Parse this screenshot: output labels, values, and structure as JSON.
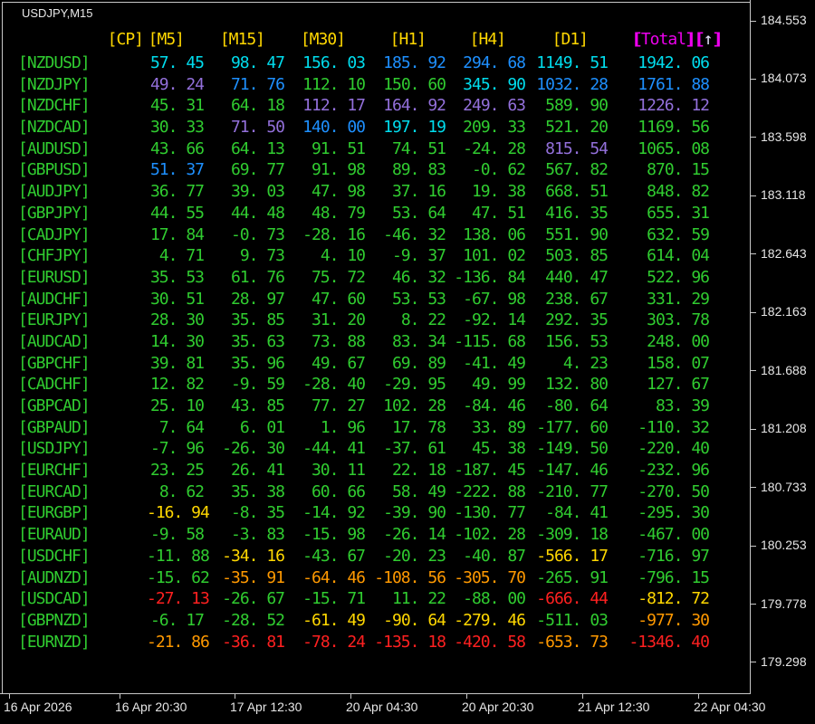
{
  "window": {
    "title": "USDJPY,M15"
  },
  "strength_table": {
    "cp_header": "[CP]",
    "tf_headers": [
      "[M5]",
      "[M15]",
      "[M30]",
      "[H1]",
      "[H4]",
      "[D1]"
    ],
    "total_header_text": "【Total】【↑】",
    "total_label": "Total",
    "sort_arrow": "↑",
    "rows": [
      {
        "pair": "[NZDUSD]",
        "values": [
          57.45,
          98.47,
          156.03,
          185.92,
          294.68,
          1149.51,
          1942.06
        ],
        "ranks": [
          "t1",
          "t1",
          "t1",
          "t2",
          "t2",
          "t1",
          "t1"
        ]
      },
      {
        "pair": "[NZDJPY]",
        "values": [
          49.24,
          71.76,
          112.1,
          150.6,
          345.9,
          1032.28,
          1761.88
        ],
        "ranks": [
          "t3",
          "t2",
          "d",
          "d",
          "t1",
          "t2",
          "t2"
        ]
      },
      {
        "pair": "[NZDCHF]",
        "values": [
          45.31,
          64.18,
          112.17,
          164.92,
          249.63,
          589.9,
          1226.12
        ],
        "ranks": [
          "d",
          "d",
          "t3",
          "t3",
          "t3",
          "d",
          "t3"
        ]
      },
      {
        "pair": "[NZDCAD]",
        "values": [
          30.33,
          71.5,
          140.0,
          197.19,
          209.33,
          521.2,
          1169.56
        ],
        "ranks": [
          "d",
          "t3",
          "t2",
          "t1",
          "d",
          "d",
          "d"
        ]
      },
      {
        "pair": "[AUDUSD]",
        "values": [
          43.66,
          64.13,
          91.51,
          74.51,
          -24.28,
          815.54,
          1065.08
        ],
        "ranks": [
          "d",
          "d",
          "d",
          "d",
          "d",
          "t3",
          "d"
        ]
      },
      {
        "pair": "[GBPUSD]",
        "values": [
          51.37,
          69.77,
          91.98,
          89.83,
          -0.62,
          567.82,
          870.15
        ],
        "ranks": [
          "t2",
          "d",
          "d",
          "d",
          "d",
          "d",
          "d"
        ]
      },
      {
        "pair": "[AUDJPY]",
        "values": [
          36.77,
          39.03,
          47.98,
          37.16,
          19.38,
          668.51,
          848.82
        ],
        "ranks": [
          "d",
          "d",
          "d",
          "d",
          "d",
          "d",
          "d"
        ]
      },
      {
        "pair": "[GBPJPY]",
        "values": [
          44.55,
          44.48,
          48.79,
          53.64,
          47.51,
          416.35,
          655.31
        ],
        "ranks": [
          "d",
          "d",
          "d",
          "d",
          "d",
          "d",
          "d"
        ]
      },
      {
        "pair": "[CADJPY]",
        "values": [
          17.84,
          -0.73,
          -28.16,
          -46.32,
          138.06,
          551.9,
          632.59
        ],
        "ranks": [
          "d",
          "d",
          "d",
          "d",
          "d",
          "d",
          "d"
        ]
      },
      {
        "pair": "[CHFJPY]",
        "values": [
          4.71,
          9.73,
          4.1,
          -9.37,
          101.02,
          503.85,
          614.04
        ],
        "ranks": [
          "d",
          "d",
          "d",
          "d",
          "d",
          "d",
          "d"
        ]
      },
      {
        "pair": "[EURUSD]",
        "values": [
          35.53,
          61.76,
          75.72,
          46.32,
          -136.84,
          440.47,
          522.96
        ],
        "ranks": [
          "d",
          "d",
          "d",
          "d",
          "d",
          "d",
          "d"
        ]
      },
      {
        "pair": "[AUDCHF]",
        "values": [
          30.51,
          28.97,
          47.6,
          53.53,
          -67.98,
          238.67,
          331.29
        ],
        "ranks": [
          "d",
          "d",
          "d",
          "d",
          "d",
          "d",
          "d"
        ]
      },
      {
        "pair": "[EURJPY]",
        "values": [
          28.3,
          35.85,
          31.2,
          8.22,
          -92.14,
          292.35,
          303.78
        ],
        "ranks": [
          "d",
          "d",
          "d",
          "d",
          "d",
          "d",
          "d"
        ]
      },
      {
        "pair": "[AUDCAD]",
        "values": [
          14.3,
          35.63,
          73.88,
          83.34,
          -115.68,
          156.53,
          248.0
        ],
        "ranks": [
          "d",
          "d",
          "d",
          "d",
          "d",
          "d",
          "d"
        ]
      },
      {
        "pair": "[GBPCHF]",
        "values": [
          39.81,
          35.96,
          49.67,
          69.89,
          -41.49,
          4.23,
          158.07
        ],
        "ranks": [
          "d",
          "d",
          "d",
          "d",
          "d",
          "d",
          "d"
        ]
      },
      {
        "pair": "[CADCHF]",
        "values": [
          12.82,
          -9.59,
          -28.4,
          -29.95,
          49.99,
          132.8,
          127.67
        ],
        "ranks": [
          "d",
          "d",
          "d",
          "d",
          "d",
          "d",
          "d"
        ]
      },
      {
        "pair": "[GBPCAD]",
        "values": [
          25.1,
          43.85,
          77.27,
          102.28,
          -84.46,
          -80.64,
          83.39
        ],
        "ranks": [
          "d",
          "d",
          "d",
          "d",
          "d",
          "d",
          "d"
        ]
      },
      {
        "pair": "[GBPAUD]",
        "values": [
          7.64,
          6.01,
          1.96,
          17.78,
          33.89,
          -177.6,
          -110.32
        ],
        "ranks": [
          "d",
          "d",
          "d",
          "d",
          "d",
          "d",
          "d"
        ]
      },
      {
        "pair": "[USDJPY]",
        "values": [
          -7.96,
          -26.3,
          -44.41,
          -37.61,
          45.38,
          -149.5,
          -220.4
        ],
        "ranks": [
          "d",
          "d",
          "d",
          "d",
          "d",
          "d",
          "d"
        ]
      },
      {
        "pair": "[EURCHF]",
        "values": [
          23.25,
          26.41,
          30.11,
          22.18,
          -187.45,
          -147.46,
          -232.96
        ],
        "ranks": [
          "d",
          "d",
          "d",
          "d",
          "d",
          "d",
          "d"
        ]
      },
      {
        "pair": "[EURCAD]",
        "values": [
          8.62,
          35.38,
          60.66,
          58.49,
          -222.88,
          -210.77,
          -270.5
        ],
        "ranks": [
          "d",
          "d",
          "d",
          "d",
          "d",
          "d",
          "d"
        ]
      },
      {
        "pair": "[EURGBP]",
        "values": [
          -16.94,
          -8.35,
          -14.92,
          -39.9,
          -130.77,
          -84.41,
          -295.3
        ],
        "ranks": [
          "b3",
          "d",
          "d",
          "d",
          "d",
          "d",
          "d"
        ]
      },
      {
        "pair": "[EURAUD]",
        "values": [
          -9.58,
          -3.83,
          -15.98,
          -26.14,
          -102.28,
          -309.18,
          -467.0
        ],
        "ranks": [
          "d",
          "d",
          "d",
          "d",
          "d",
          "d",
          "d"
        ]
      },
      {
        "pair": "[USDCHF]",
        "values": [
          -11.88,
          -34.16,
          -43.67,
          -20.23,
          -40.87,
          -566.17,
          -716.97
        ],
        "ranks": [
          "d",
          "b3",
          "d",
          "d",
          "d",
          "b3",
          "d"
        ]
      },
      {
        "pair": "[AUDNZD]",
        "values": [
          -15.62,
          -35.91,
          -64.46,
          -108.56,
          -305.7,
          -265.91,
          -796.15
        ],
        "ranks": [
          "d",
          "b2",
          "b2",
          "b2",
          "b2",
          "d",
          "d"
        ]
      },
      {
        "pair": "[USDCAD]",
        "values": [
          -27.13,
          -26.67,
          -15.71,
          11.22,
          -88.0,
          -666.44,
          -812.72
        ],
        "ranks": [
          "b1",
          "d",
          "d",
          "d",
          "d",
          "b1",
          "b3"
        ]
      },
      {
        "pair": "[GBPNZD]",
        "values": [
          -6.17,
          -28.52,
          -61.49,
          -90.64,
          -279.46,
          -511.03,
          -977.3
        ],
        "ranks": [
          "d",
          "d",
          "b3",
          "b3",
          "b3",
          "d",
          "b2"
        ]
      },
      {
        "pair": "[EURNZD]",
        "values": [
          -21.86,
          -36.81,
          -78.24,
          -135.18,
          -420.58,
          -653.73,
          -1346.4
        ],
        "ranks": [
          "b2",
          "b1",
          "b1",
          "b1",
          "b1",
          "b2",
          "b1"
        ]
      }
    ]
  },
  "rank_colors": {
    "d": "#30CC30",
    "t1": "#00DDEE",
    "t2": "#1E90FF",
    "t3": "#9370DB",
    "b1": "#FF2020",
    "b2": "#FF9900",
    "b3": "#FFD700"
  },
  "header_colors": {
    "timeframe": "#FFD700",
    "total": "#EE00EE",
    "arrow": "#E8E8FF"
  },
  "price_axis": {
    "labels": [
      "184.553",
      "184.073",
      "183.598",
      "183.118",
      "182.643",
      "182.163",
      "181.688",
      "181.208",
      "180.733",
      "180.253",
      "179.778",
      "179.298"
    ]
  },
  "time_axis": {
    "labels": [
      "16 Apr 2026",
      "16 Apr 20:30",
      "17 Apr 12:30",
      "20 Apr 04:30",
      "20 Apr 20:30",
      "21 Apr 12:30",
      "22 Apr 04:30"
    ]
  }
}
